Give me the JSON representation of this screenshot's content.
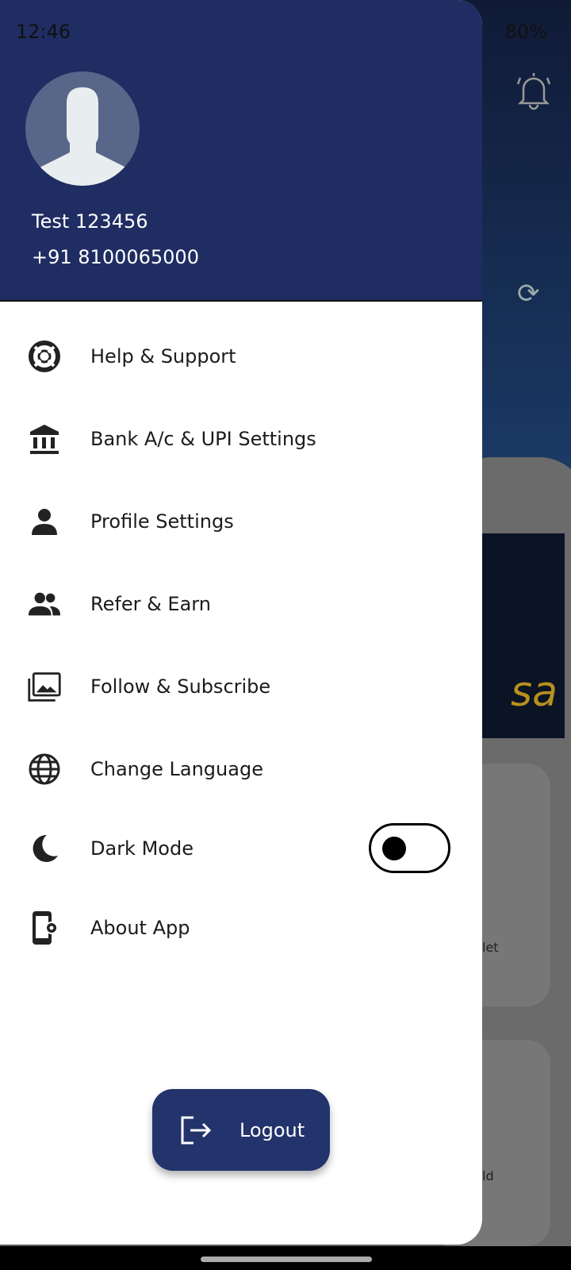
{
  "status_bar": {
    "time": "12:46",
    "battery": "80%",
    "icons": [
      "gallery-icon",
      "chat-icon",
      "gmail-icon",
      "wifi-icon",
      "volte-lte1-icon",
      "signal-icon",
      "volte-lte2-icon",
      "signal-icon",
      "battery-icon"
    ]
  },
  "background": {
    "card1_label": "let",
    "card2_label": "ld",
    "banner_text": "sa"
  },
  "drawer": {
    "user_name": "Test 123456",
    "phone": "+91 8100065000",
    "items": [
      {
        "label": "Help & Support",
        "icon": "lifebuoy-icon"
      },
      {
        "label": "Bank A/c & UPI Settings",
        "icon": "bank-icon"
      },
      {
        "label": "Profile Settings",
        "icon": "person-icon"
      },
      {
        "label": "Refer & Earn",
        "icon": "people-icon"
      },
      {
        "label": "Follow & Subscribe",
        "icon": "photo-library-icon"
      },
      {
        "label": "Change Language",
        "icon": "globe-icon"
      },
      {
        "label": "Dark Mode",
        "icon": "moon-icon"
      },
      {
        "label": "About App",
        "icon": "phone-settings-icon"
      }
    ],
    "dark_mode_on": false,
    "logout_label": "Logout"
  },
  "colors": {
    "header": "#1f2d62",
    "button": "#23336b"
  }
}
